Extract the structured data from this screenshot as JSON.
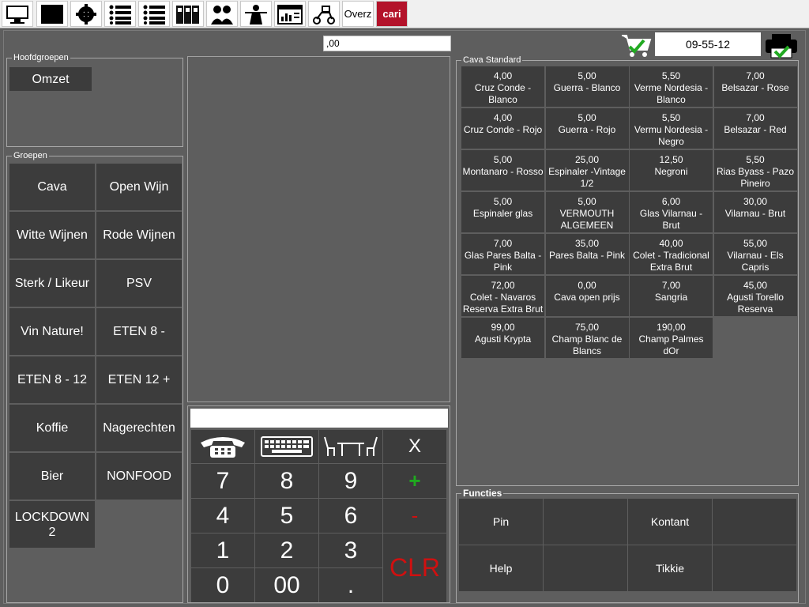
{
  "toolbar": {
    "icons": [
      "monitor-icon",
      "black-screen-icon",
      "gear-icon",
      "list-icon",
      "list-alt-icon",
      "binders-icon",
      "staff-icon",
      "waiter-icon",
      "report-icon",
      "delivery-scooter-icon"
    ],
    "overz_label": "Overz",
    "brand_label": "cari"
  },
  "header": {
    "amount": ",00",
    "order_number": "09-55-12"
  },
  "hoofdgroepen": {
    "legend": "Hoofdgroepen",
    "items": [
      "Omzet"
    ]
  },
  "groepen": {
    "legend": "Groepen",
    "items": [
      "Cava",
      "Open Wijn",
      "Witte Wijnen",
      "Rode Wijnen",
      "Sterk / Likeur",
      "PSV",
      "Vin Nature!",
      "ETEN 8 -",
      "ETEN 8 - 12",
      "ETEN 12 +",
      "Koffie",
      "Nagerechten",
      "Bier",
      "NONFOOD",
      "LOCKDOWN 2"
    ]
  },
  "products": {
    "legend": "Cava Standard",
    "items": [
      {
        "price": "4,00",
        "name": "Cruz Conde - Blanco"
      },
      {
        "price": "5,00",
        "name": "Guerra - Blanco"
      },
      {
        "price": "5,50",
        "name": "Verme Nordesia - Blanco"
      },
      {
        "price": "7,00",
        "name": "Belsazar - Rose"
      },
      {
        "price": "4,00",
        "name": "Cruz Conde - Rojo"
      },
      {
        "price": "5,00",
        "name": "Guerra - Rojo"
      },
      {
        "price": "5,50",
        "name": "Vermu Nordesia - Negro"
      },
      {
        "price": "7,00",
        "name": "Belsazar - Red"
      },
      {
        "price": "5,00",
        "name": "Montanaro - Rosso"
      },
      {
        "price": "25,00",
        "name": "Espinaler -Vintage 1/2"
      },
      {
        "price": "12,50",
        "name": "Negroni"
      },
      {
        "price": "5,50",
        "name": "Rias Byass - Pazo Pineiro"
      },
      {
        "price": "5,00",
        "name": "Espinaler glas"
      },
      {
        "price": "5,00",
        "name": "VERMOUTH ALGEMEEN"
      },
      {
        "price": "6,00",
        "name": "Glas Vilarnau - Brut"
      },
      {
        "price": "30,00",
        "name": "Vilarnau - Brut"
      },
      {
        "price": "7,00",
        "name": "Glas Pares Balta - Pink"
      },
      {
        "price": "35,00",
        "name": "Pares Balta - Pink"
      },
      {
        "price": "40,00",
        "name": "Colet - Tradicional Extra Brut"
      },
      {
        "price": "55,00",
        "name": "Vilarnau - Els Capris"
      },
      {
        "price": "72,00",
        "name": "Colet - Navaros Reserva Extra Brut"
      },
      {
        "price": "0,00",
        "name": "Cava open prijs"
      },
      {
        "price": "7,00",
        "name": "Sangria"
      },
      {
        "price": "45,00",
        "name": "Agusti Torello Reserva"
      },
      {
        "price": "99,00",
        "name": "Agusti Krypta"
      },
      {
        "price": "75,00",
        "name": "Champ Blanc de Blancs"
      },
      {
        "price": "190,00",
        "name": "Champ Palmes dOr"
      }
    ]
  },
  "keypad": {
    "display": "",
    "icons": [
      "telephone-icon",
      "keyboard-icon",
      "table-chairs-icon"
    ],
    "close": "X",
    "digits": [
      "7",
      "8",
      "9",
      "4",
      "5",
      "6",
      "1",
      "2",
      "3",
      "0",
      "00",
      "."
    ],
    "plus": "+",
    "minus": "-",
    "clear": "CLR"
  },
  "functies": {
    "legend": "Functies",
    "items": [
      "Pin",
      "",
      "Kontant",
      "",
      "Help",
      "",
      "Tikkie",
      ""
    ]
  },
  "colors": {
    "plus": "#1faa1f",
    "minus": "#d01010",
    "clear": "#d01010",
    "background": "#5e5e5e",
    "button": "#3c3c3c"
  }
}
